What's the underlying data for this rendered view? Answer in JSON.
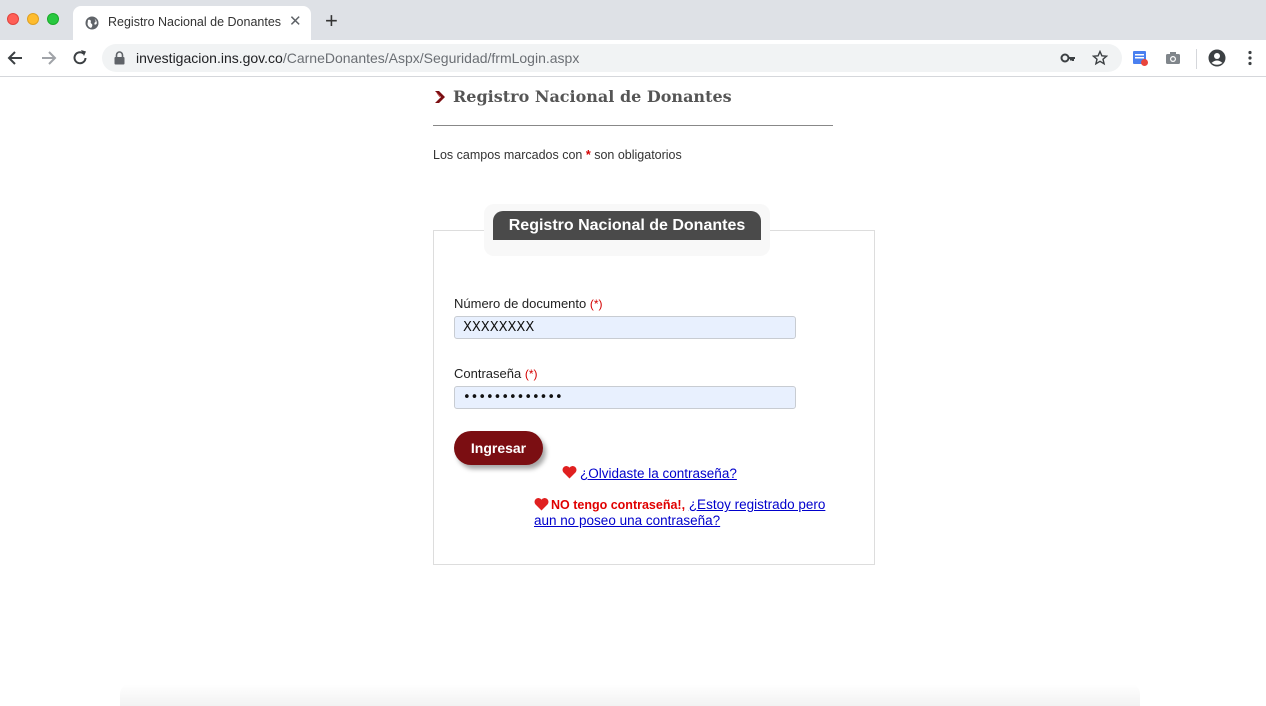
{
  "browser": {
    "tab_title": "Registro Nacional de Donantes",
    "tab_close": "✕",
    "new_tab": "+",
    "url_host": "investigacion.ins.gov.co",
    "url_path": "/CarneDonantes/Aspx/Seguridad/frmLogin.aspx"
  },
  "page": {
    "heading": "Registro Nacional de Donantes",
    "required_note_prefix": "Los campos marcados con ",
    "required_note_star": "*",
    "required_note_suffix": " son obligatorios",
    "form_title": "Registro Nacional de Donantes",
    "document_label": "Número de documento",
    "document_required": "(*)",
    "document_value": "XXXXXXXX",
    "password_label": "Contraseña",
    "password_required": "(*)",
    "password_value": "•••••••••••••",
    "submit_label": "Ingresar",
    "forgot_link": "¿Olvidaste la contraseña?",
    "no_password_warning": "NO tengo contraseña!,",
    "registered_link": "¿Estoy registrado pero aun no poseo una contraseña?"
  },
  "colors": {
    "accent": "#7b0e12",
    "required": "#d40000",
    "link": "#0000cc",
    "input_bg": "#e8f0fe"
  }
}
